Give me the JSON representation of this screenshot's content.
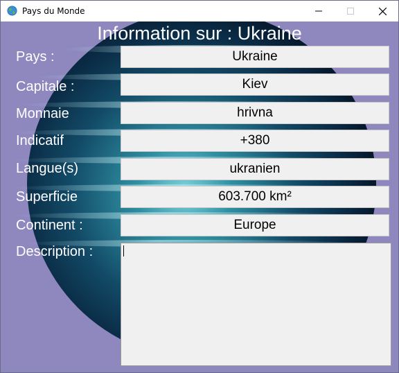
{
  "window": {
    "title": "Pays du Monde",
    "icon": "globe-icon"
  },
  "heading": "Information sur : Ukraine",
  "fields": [
    {
      "label": "Pays :",
      "value": "Ukraine"
    },
    {
      "label": "Capitale :",
      "value": "Kiev"
    },
    {
      "label": "Monnaie",
      "value": "hrivna"
    },
    {
      "label": "Indicatif",
      "value": "+380"
    },
    {
      "label": "Langue(s)",
      "value": "ukranien"
    },
    {
      "label": "Superficie",
      "value": "603.700 km²"
    },
    {
      "label": "Continent :",
      "value": "Europe"
    }
  ],
  "description": {
    "label": "Description :",
    "value": ""
  },
  "colors": {
    "background": "#8e88bf",
    "field": "#f0f0f0",
    "label_text": "#ffffff"
  }
}
